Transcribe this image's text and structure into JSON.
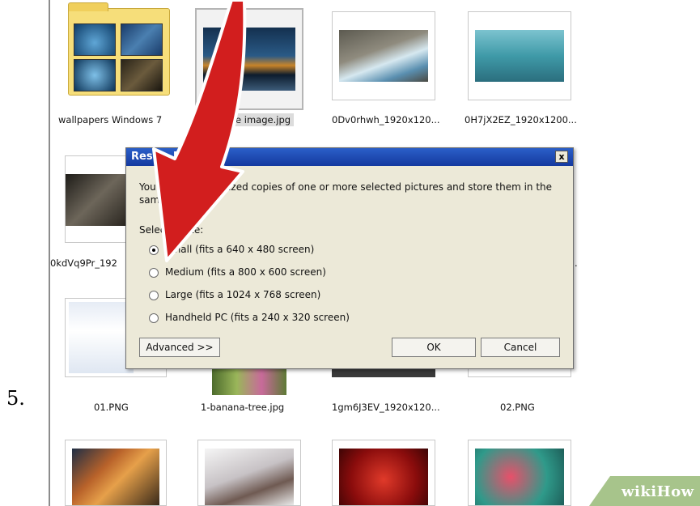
{
  "step_number": "5.",
  "files": {
    "row1": [
      {
        "name": "wallpapers Windows 7"
      },
      {
        "name": "Sample image.jpg"
      },
      {
        "name": "0Dv0rhwh_1920x120..."
      },
      {
        "name": "0H7jX2EZ_1920x1200..."
      }
    ],
    "row2_first": {
      "name": "0kdVq9Pr_192"
    },
    "row2_end": ".",
    "row3": [
      {
        "name": "01.PNG"
      },
      {
        "name": "1-banana-tree.jpg"
      },
      {
        "name": "1gm6J3EV_1920x120..."
      },
      {
        "name": "02.PNG"
      }
    ]
  },
  "dialog": {
    "title": "Resize Pictures",
    "description": "You can create resized copies of one or more selected pictures and store them in the same folder.",
    "select_label": "Select a size:",
    "options": [
      {
        "label": "Small (fits a 640 x 480 screen)",
        "selected": true
      },
      {
        "label": "Medium (fits a 800 x 600 screen)",
        "selected": false
      },
      {
        "label": "Large (fits a 1024 x 768 screen)",
        "selected": false
      },
      {
        "label": "Handheld PC (fits a 240 x 320 screen)",
        "selected": false
      }
    ],
    "advanced_label": "Advanced >>",
    "ok_label": "OK",
    "cancel_label": "Cancel",
    "close_label": "x"
  },
  "watermark": "wikiHow",
  "colors": {
    "arrow": "#d21e1e",
    "titlebar": "#1f4fb8",
    "dialog_bg": "#ece9d8",
    "watermark": "#a7c48b"
  }
}
